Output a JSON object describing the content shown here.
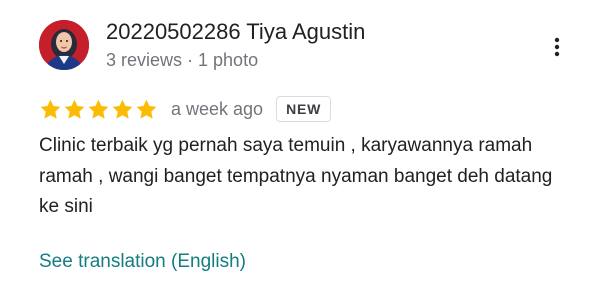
{
  "review": {
    "author_name": "20220502286 Tiya Agustin",
    "author_meta": "3 reviews · 1 photo",
    "avatar_icon": "profile-photo",
    "more_icon": "more-vert-icon",
    "rating": 5,
    "rating_max": 5,
    "star_color": "#fbbc04",
    "time_ago": "a week ago",
    "badge": "NEW",
    "text": "Clinic terbaik yg pernah saya temuin , karyawannya ramah ramah , wangi banget tempatnya nyaman banget deh datang ke sini",
    "translate_link": "See translation (English)",
    "link_color": "#137d82"
  }
}
